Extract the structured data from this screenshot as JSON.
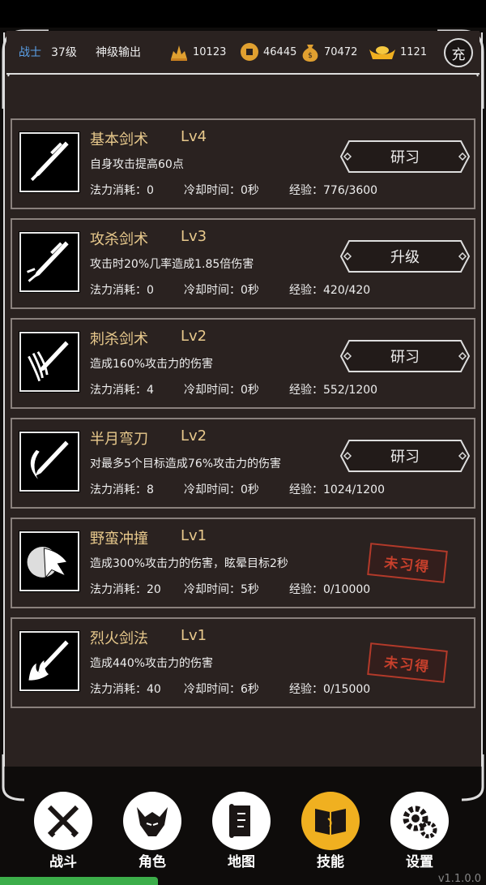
{
  "header": {
    "class_name": "战士",
    "level": "37级",
    "title": "神级输出",
    "resources": [
      {
        "icon": "gold-pile-icon",
        "value": "10123"
      },
      {
        "icon": "coin-icon",
        "value": "46445"
      },
      {
        "icon": "money-bag-icon",
        "value": "70472"
      },
      {
        "icon": "ingot-icon",
        "value": "1121"
      }
    ],
    "recharge_label": "充"
  },
  "skills": [
    {
      "name": "基本剑术",
      "level": "Lv4",
      "desc": "自身攻击提高60点",
      "mana": "法力消耗：0",
      "cooldown": "冷却时间：0秒",
      "exp": "经验：776/3600",
      "action": "研习",
      "learned": true
    },
    {
      "name": "攻杀剑术",
      "level": "Lv3",
      "desc": "攻击时20%几率造成1.85倍伤害",
      "mana": "法力消耗：0",
      "cooldown": "冷却时间：0秒",
      "exp": "经验：420/420",
      "action": "升级",
      "learned": true
    },
    {
      "name": "刺杀剑术",
      "level": "Lv2",
      "desc": "造成160%攻击力的伤害",
      "mana": "法力消耗：4",
      "cooldown": "冷却时间：0秒",
      "exp": "经验：552/1200",
      "action": "研习",
      "learned": true
    },
    {
      "name": "半月弯刀",
      "level": "Lv2",
      "desc": "对最多5个目标造成76%攻击力的伤害",
      "mana": "法力消耗：8",
      "cooldown": "冷却时间：0秒",
      "exp": "经验：1024/1200",
      "action": "研习",
      "learned": true
    },
    {
      "name": "野蛮冲撞",
      "level": "Lv1",
      "desc": "造成300%攻击力的伤害，眩晕目标2秒",
      "mana": "法力消耗：20",
      "cooldown": "冷却时间：5秒",
      "exp": "经验：0/10000",
      "stamp": "未习得",
      "learned": false
    },
    {
      "name": "烈火剑法",
      "level": "Lv1",
      "desc": "造成440%攻击力的伤害",
      "mana": "法力消耗：40",
      "cooldown": "冷却时间：6秒",
      "exp": "经验：0/15000",
      "stamp": "未习得",
      "learned": false
    }
  ],
  "nav": [
    {
      "label": "战斗",
      "icon": "crossed-swords-icon"
    },
    {
      "label": "角色",
      "icon": "helmet-icon"
    },
    {
      "label": "地图",
      "icon": "scroll-map-icon"
    },
    {
      "label": "技能",
      "icon": "spellbook-icon",
      "active": true
    },
    {
      "label": "设置",
      "icon": "gears-icon"
    }
  ],
  "version": "v1.1.0.0"
}
